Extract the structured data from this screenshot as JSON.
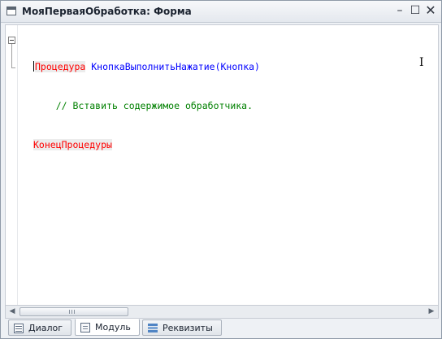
{
  "window": {
    "title": "МояПерваяОбработка: Форма",
    "buttons": {
      "minimize": "–",
      "maximize": "☐",
      "close": "✕"
    }
  },
  "code": {
    "line1": {
      "keyword": "Процедура",
      "name": "КнопкаВыполнитьНажатие",
      "params": "(Кнопка)"
    },
    "line2": {
      "comment": "// Вставить содержимое обработчика."
    },
    "line3": {
      "keyword": "КонецПроцедуры"
    }
  },
  "scrollbar": {
    "left_arrow": "◀",
    "right_arrow": "▶"
  },
  "tabs": [
    {
      "label": "Диалог",
      "icon": "dialog-icon",
      "active": false
    },
    {
      "label": "Модуль",
      "icon": "module-icon",
      "active": true
    },
    {
      "label": "Реквизиты",
      "icon": "attributes-icon",
      "active": false
    }
  ],
  "colors": {
    "keyword": "#ff0000",
    "identifier": "#0000ff",
    "comment": "#008000"
  }
}
